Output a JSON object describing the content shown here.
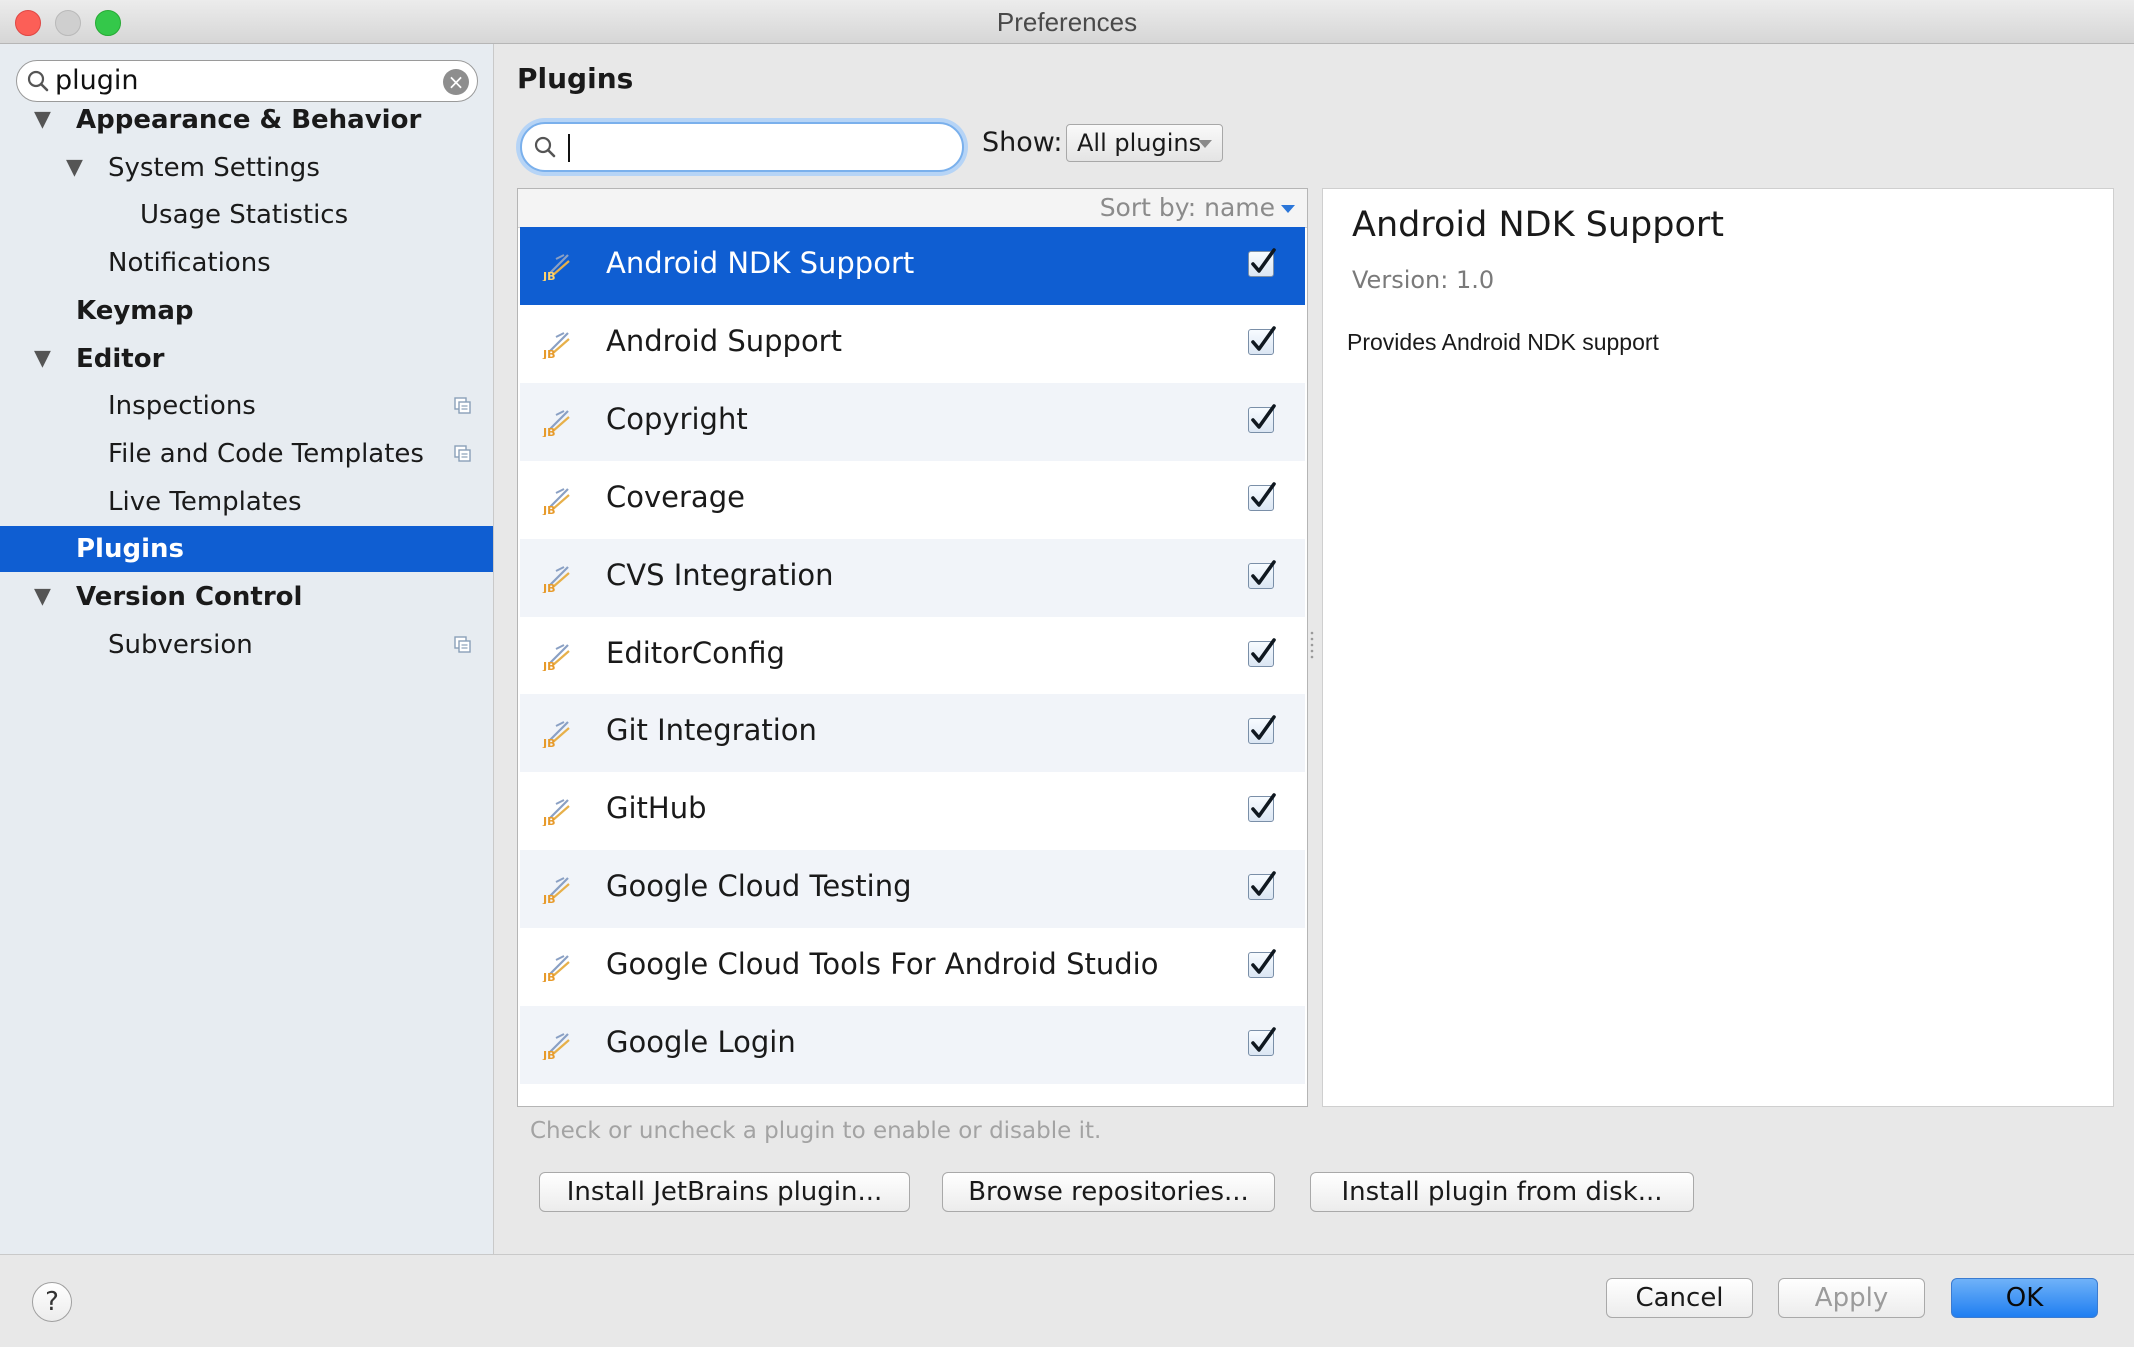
{
  "window": {
    "title": "Preferences"
  },
  "sidebar": {
    "search": {
      "value": "plugin",
      "placeholder": ""
    },
    "items": [
      {
        "label": "Appearance & Behavior",
        "level": 0,
        "expanded": true,
        "bold": true
      },
      {
        "label": "System Settings",
        "level": 1,
        "expanded": true
      },
      {
        "label": "Usage Statistics",
        "level": 2
      },
      {
        "label": "Notifications",
        "level": 1
      },
      {
        "label": "Keymap",
        "level": 0,
        "bold": true
      },
      {
        "label": "Editor",
        "level": 0,
        "expanded": true,
        "bold": true
      },
      {
        "label": "Inspections",
        "level": 1,
        "icon": "copy-icon"
      },
      {
        "label": "File and Code Templates",
        "level": 1,
        "icon": "copy-icon"
      },
      {
        "label": "Live Templates",
        "level": 1
      },
      {
        "label": "Plugins",
        "level": 0,
        "bold": true,
        "selected": true
      },
      {
        "label": "Version Control",
        "level": 0,
        "expanded": true,
        "bold": true
      },
      {
        "label": "Subversion",
        "level": 1,
        "icon": "copy-icon"
      }
    ]
  },
  "main": {
    "title": "Plugins",
    "search": {
      "value": "",
      "placeholder": ""
    },
    "show_label": "Show:",
    "show_selected": "All plugins",
    "sort_label": "Sort by: name",
    "plugins": [
      {
        "name": "Android NDK Support",
        "checked": true,
        "selected": true
      },
      {
        "name": "Android Support",
        "checked": true
      },
      {
        "name": "Copyright",
        "checked": true
      },
      {
        "name": "Coverage",
        "checked": true
      },
      {
        "name": "CVS Integration",
        "checked": true
      },
      {
        "name": "EditorConfig",
        "checked": true
      },
      {
        "name": "Git Integration",
        "checked": true
      },
      {
        "name": "GitHub",
        "checked": true
      },
      {
        "name": "Google Cloud Testing",
        "checked": true
      },
      {
        "name": "Google Cloud Tools For Android Studio",
        "checked": true
      },
      {
        "name": "Google Login",
        "checked": true
      }
    ],
    "detail": {
      "name": "Android NDK Support",
      "version": "Version: 1.0",
      "description": "Provides Android NDK support"
    },
    "hint": "Check or uncheck a plugin to enable or disable it.",
    "buttons": {
      "install_jetbrains": "Install JetBrains plugin...",
      "browse": "Browse repositories...",
      "install_disk": "Install plugin from disk..."
    }
  },
  "footer": {
    "help": "?",
    "cancel": "Cancel",
    "apply": "Apply",
    "ok": "OK"
  },
  "colors": {
    "selection": "#0f5ed2",
    "sidebar_bg": "#e7ecf1",
    "ok_button": "#1f7ef1"
  }
}
